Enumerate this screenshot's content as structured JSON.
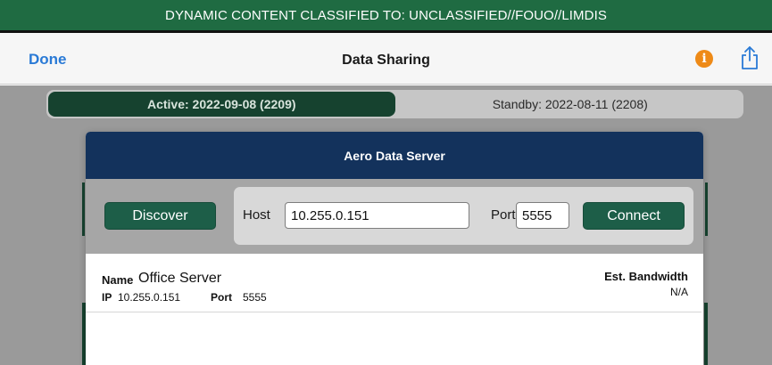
{
  "banner": {
    "text": "DYNAMIC CONTENT CLASSIFIED TO: UNCLASSIFIED//FOUO//LIMDIS"
  },
  "navbar": {
    "done_label": "Done",
    "title": "Data Sharing",
    "info_icon": "info-circle-icon",
    "share_icon": "share-icon"
  },
  "segments": [
    {
      "label": "Active: 2022-09-08 (2209)",
      "selected": true
    },
    {
      "label": "Standby: 2022-08-11 (2208)",
      "selected": false
    }
  ],
  "modal": {
    "title": "Aero Data Server",
    "discover_label": "Discover",
    "host_label": "Host",
    "host_value": "10.255.0.151",
    "port_label": "Port",
    "port_value": "5555",
    "connect_label": "Connect"
  },
  "servers": [
    {
      "name_label": "Name",
      "name": "Office Server",
      "ip_label": "IP",
      "ip": "10.255.0.151",
      "port_label": "Port",
      "port": "5555",
      "bandwidth_label": "Est. Bandwidth",
      "bandwidth": "N/A"
    }
  ],
  "colors": {
    "banner": "#1f6b42",
    "accent_blue": "#2a7ad6",
    "info_orange": "#ee8a17",
    "modal_header": "#13325c",
    "button_green": "#1d5e48",
    "segment_active": "#16422f"
  }
}
